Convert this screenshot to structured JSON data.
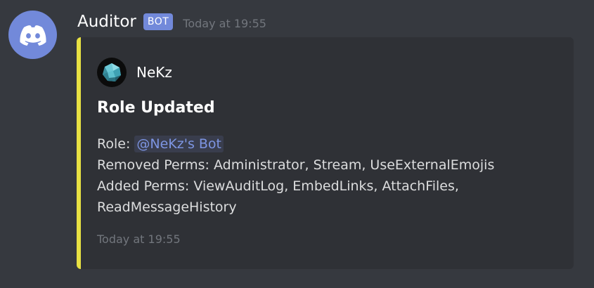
{
  "message": {
    "username": "Auditor",
    "bot_tag": "BOT",
    "timestamp": "Today at 19:55",
    "avatar_icon": "discord-logo-icon"
  },
  "embed": {
    "accent_color": "#e8e143",
    "author": {
      "name": "NeKz",
      "icon": "crystal-ball-icon"
    },
    "title": "Role Updated",
    "description": {
      "role_label": "Role: ",
      "role_mention": "@NeKz's Bot",
      "removed_line": "Removed Perms: Administrator, Stream, UseExternalEmojis",
      "added_line_1": "Added Perms: ViewAuditLog, EmbedLinks, AttachFiles,",
      "added_line_2": "ReadMessageHistory"
    },
    "footer": "Today at 19:55"
  },
  "colors": {
    "background": "#36393f",
    "embed_background": "#2f3136",
    "blurple": "#7289da",
    "muted_text": "#72767d"
  }
}
